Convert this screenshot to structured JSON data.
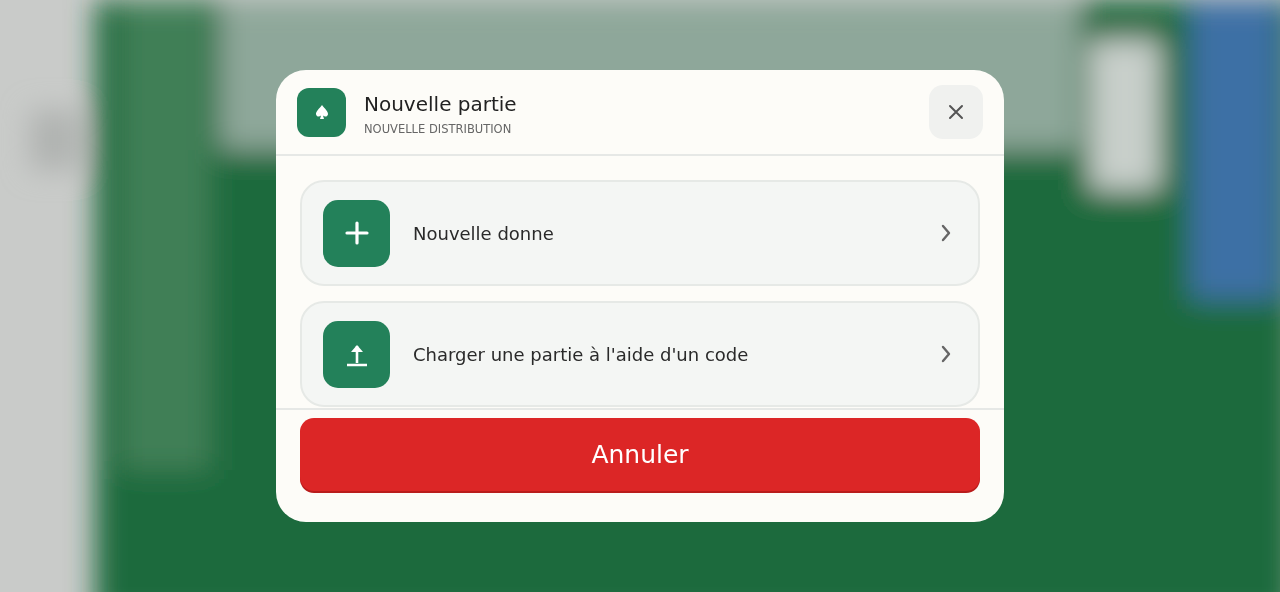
{
  "dialog": {
    "title": "Nouvelle partie",
    "subtitle": "NOUVELLE DISTRIBUTION",
    "options": [
      {
        "kind": "new",
        "label": "Nouvelle donne"
      },
      {
        "kind": "load",
        "label": "Charger une partie à l'aide d'un code"
      }
    ],
    "cancel_button": "Annuler"
  }
}
